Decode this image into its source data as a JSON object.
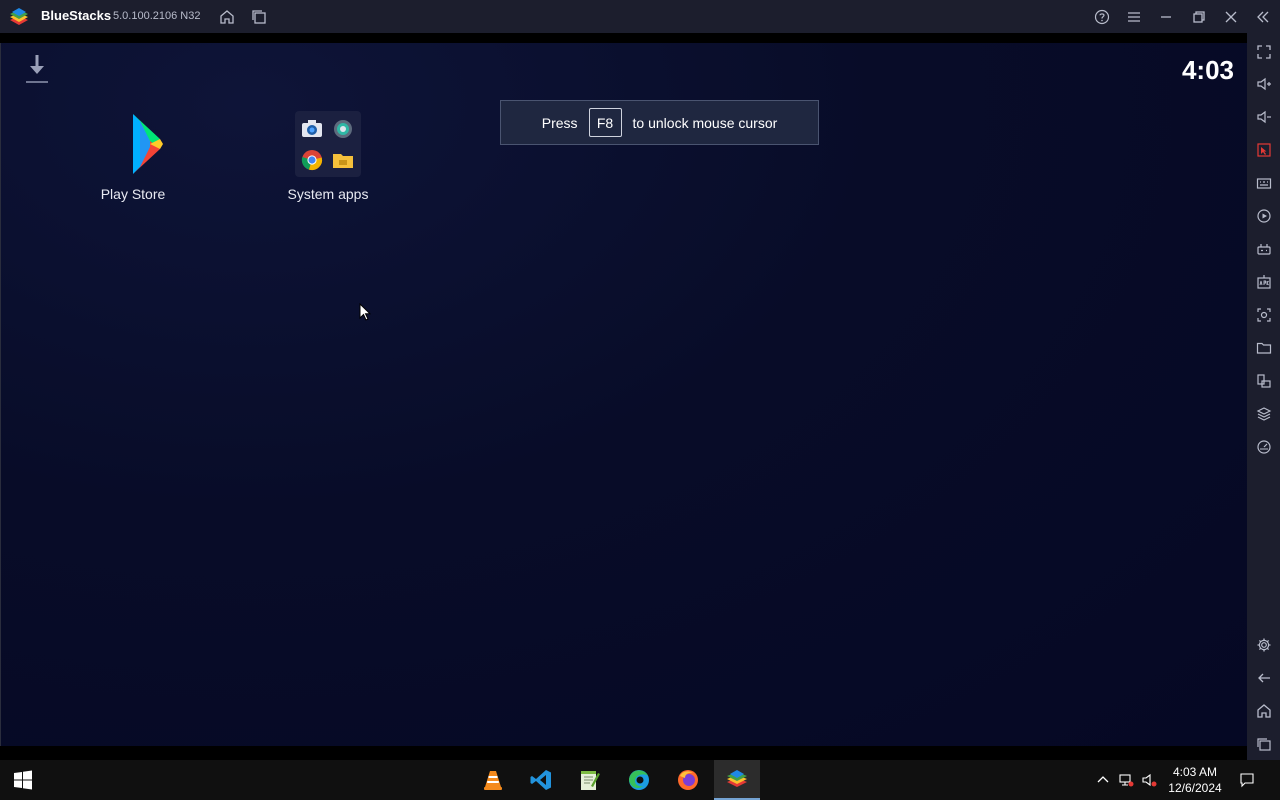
{
  "window": {
    "app_name": "BlueStacks",
    "version": "5.0.100.2106 N32"
  },
  "screen": {
    "clock": "4:03",
    "toast": {
      "prefix": "Press",
      "key": "F8",
      "suffix": "to unlock mouse cursor"
    },
    "apps": [
      {
        "label": "Play Store",
        "icon": "play-store-icon"
      },
      {
        "label": "System apps",
        "icon": "system-apps-folder-icon"
      }
    ]
  },
  "titlebar_icons": [
    "home-icon",
    "multi-instance-icon",
    "help-icon",
    "menu-icon",
    "minimize-icon",
    "restore-icon",
    "close-icon",
    "collapse-sidebar-icon"
  ],
  "sidebar_icons": [
    "fullscreen-icon",
    "volume-up-icon",
    "volume-down-icon",
    "cursor-lock-icon",
    "keyboard-controls-icon",
    "macro-icon",
    "gamepad-icon",
    "apk-install-icon",
    "screenshot-icon",
    "folder-icon",
    "multi-instance-icon",
    "layers-icon",
    "eco-mode-icon",
    "settings-icon",
    "back-icon",
    "home-icon",
    "recent-apps-icon"
  ],
  "taskbar": {
    "apps": [
      "vlc-icon",
      "vscode-icon",
      "notepadpp-icon",
      "edge-icon",
      "firefox-icon",
      "bluestacks-icon"
    ],
    "time": "4:03 AM",
    "date": "12/6/2024"
  },
  "colors": {
    "titlebar": "#1c1e2d",
    "screen_bg": "#080c28",
    "taskbar": "#101010",
    "accent": "#75a4d4"
  }
}
